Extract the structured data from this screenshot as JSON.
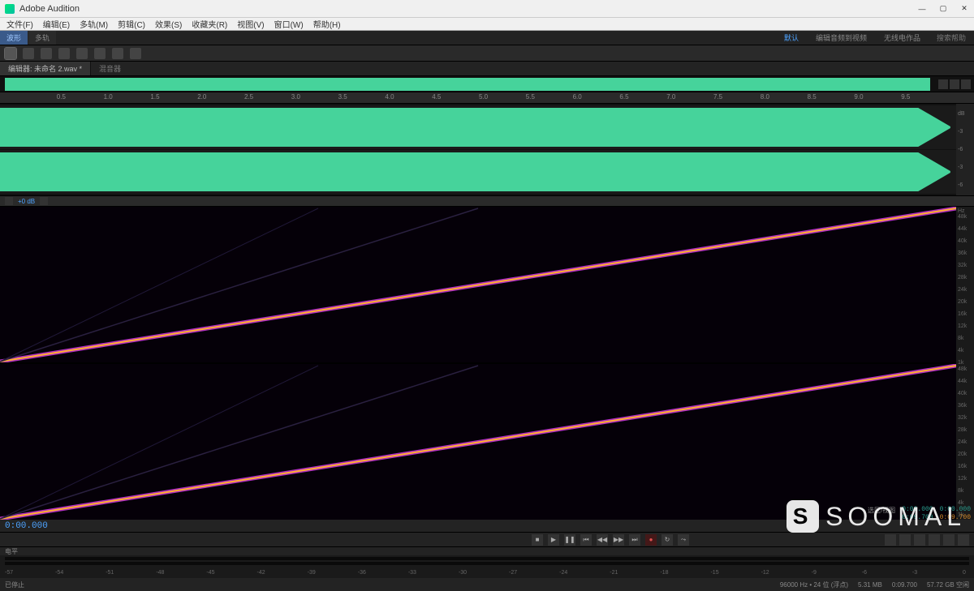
{
  "titlebar": {
    "app_name": "Adobe Audition"
  },
  "menu": {
    "items": [
      "文件(F)",
      "编辑(E)",
      "多轨(M)",
      "剪辑(C)",
      "效果(S)",
      "收藏夹(R)",
      "视图(V)",
      "窗口(W)",
      "帮助(H)"
    ]
  },
  "workspace": {
    "modes": [
      "波形",
      "多轨"
    ],
    "active_mode": 0,
    "right_tabs": [
      "默认",
      "编辑音频到视频",
      "无线电作品"
    ],
    "active_right": 0,
    "search_placeholder": "搜索帮助"
  },
  "file_tabs": {
    "active": "编辑器: 未命名 2.wav *",
    "inactive": "混音器"
  },
  "ruler": {
    "ticks": [
      "0.5",
      "1.0",
      "1.5",
      "2.0",
      "2.5",
      "3.0",
      "3.5",
      "4.0",
      "4.5",
      "5.0",
      "5.5",
      "6.0",
      "6.5",
      "7.0",
      "7.5",
      "8.0",
      "8.5",
      "9.0",
      "9.5"
    ]
  },
  "wave_scale": {
    "unit": "dB",
    "ticks": [
      "-3",
      "-6",
      "-3",
      "-6"
    ]
  },
  "spectral_header": {
    "readout": "+0 dB"
  },
  "spectral_scale": {
    "unit": "Hz",
    "ticks_left": [
      "48k",
      "44k",
      "40k",
      "36k",
      "32k",
      "28k",
      "24k",
      "20k",
      "16k",
      "12k",
      "8k",
      "4k",
      "1k"
    ],
    "ticks_right": [
      "48k",
      "44k",
      "40k",
      "36k",
      "32k",
      "28k",
      "24k",
      "20k",
      "16k",
      "12k",
      "8k",
      "4k",
      "1k"
    ]
  },
  "timecode": "0:00.000",
  "level_scale": {
    "ticks": [
      "-57",
      "-54",
      "-51",
      "-48",
      "-45",
      "-42",
      "-39",
      "-36",
      "-33",
      "-30",
      "-27",
      "-24",
      "-21",
      "-18",
      "-15",
      "-12",
      "-9",
      "-6",
      "-3",
      "0"
    ]
  },
  "level_label": "电平",
  "info": {
    "selection_label": "选区/视图",
    "sel_start": "0:00.000",
    "sel_end": "0:00.000",
    "view_start": "0:09.700",
    "view_end": "0:09.700"
  },
  "status": {
    "left": "已停止",
    "sample": "96000 Hz • 24 位 (浮点)",
    "duration": "0:09.700",
    "size": "57.72 GB 空闲",
    "timing": "5.31 MB"
  },
  "watermark": "SOOMAL"
}
